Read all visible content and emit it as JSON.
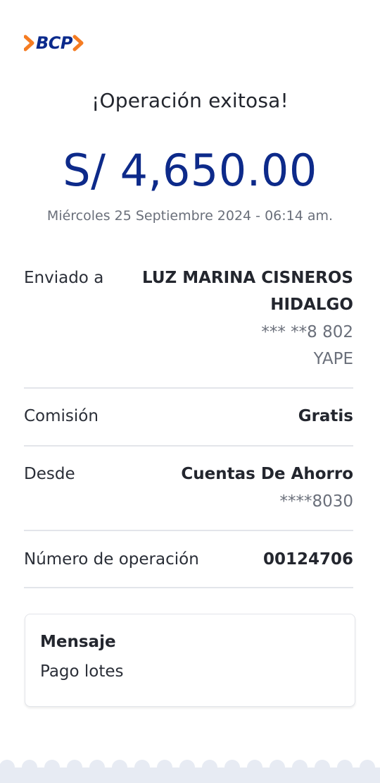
{
  "logo": {
    "text": "BCP",
    "accent_color": "#f57c22",
    "brand_color": "#0a2a8c"
  },
  "title": "¡Operación exitosa!",
  "amount": "S/ 4,650.00",
  "datetime": "Miércoles 25 Septiembre 2024 - 06:14 am.",
  "details": {
    "sent_to": {
      "label": "Enviado a",
      "name_line1": "LUZ MARINA CISNEROS",
      "name_line2": "HIDALGO",
      "phone": "*** **8 802",
      "channel": "YAPE"
    },
    "commission": {
      "label": "Comisión",
      "value": "Gratis"
    },
    "from": {
      "label": "Desde",
      "value": "Cuentas De Ahorro",
      "account": "****8030"
    },
    "operation_number": {
      "label": "Número de operación",
      "value": "00124706"
    }
  },
  "message": {
    "title": "Mensaje",
    "body": "Pago lotes"
  }
}
